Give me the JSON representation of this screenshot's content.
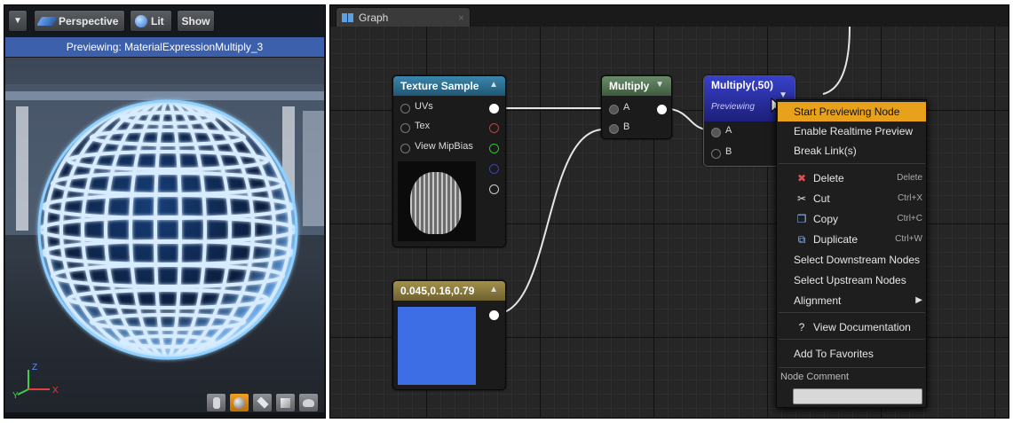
{
  "viewport": {
    "view_mode_label": "Perspective",
    "lit_label": "Lit",
    "show_label": "Show",
    "preview_banner": "Previewing: MaterialExpressionMultiply_3",
    "axis_labels": {
      "x": "X",
      "y": "Y",
      "z": "Z"
    },
    "preview_shapes": [
      "cylinder-icon",
      "sphere-icon",
      "plane-icon",
      "cube-icon",
      "custom-mesh-icon"
    ]
  },
  "graph": {
    "tab_label": "Graph",
    "tab_close": "×"
  },
  "nodes": {
    "texture_sample": {
      "title": "Texture Sample",
      "header_color": "#2d6f8f",
      "pins": [
        "UVs",
        "Tex",
        "View MipBias"
      ]
    },
    "multiply": {
      "title": "Multiply",
      "header_color": "#4f6e4f",
      "pins": [
        "A",
        "B"
      ]
    },
    "multiply_const": {
      "title": "Multiply(,50)",
      "subtitle": "Previewing",
      "header_color": "#2a2f9a",
      "pins": [
        "A",
        "B"
      ]
    },
    "constant3": {
      "title": "0.045,0.16,0.79",
      "header_color": "#8a7a3a",
      "swatch_color": "#3e6ee6"
    }
  },
  "context_menu": {
    "items": [
      {
        "label": "Start Previewing Node",
        "highlighted": true
      },
      {
        "label": "Enable Realtime Preview"
      },
      {
        "label": "Break Link(s)"
      },
      {
        "label": "Delete",
        "shortcut": "Delete",
        "icon": "delete-icon"
      },
      {
        "label": "Cut",
        "shortcut": "Ctrl+X",
        "icon": "scissors-icon"
      },
      {
        "label": "Copy",
        "shortcut": "Ctrl+C",
        "icon": "copy-icon"
      },
      {
        "label": "Duplicate",
        "shortcut": "Ctrl+W",
        "icon": "duplicate-icon"
      },
      {
        "label": "Select Downstream Nodes"
      },
      {
        "label": "Select Upstream Nodes"
      },
      {
        "label": "Alignment",
        "submenu": true
      },
      {
        "label": "View Documentation",
        "icon": "help-icon"
      },
      {
        "label": "Add To Favorites"
      }
    ],
    "comment_label": "Node Comment",
    "comment_value": ""
  },
  "colors": {
    "menu_highlight": "#e8a11a",
    "preview_banner": "#3d60ad"
  }
}
